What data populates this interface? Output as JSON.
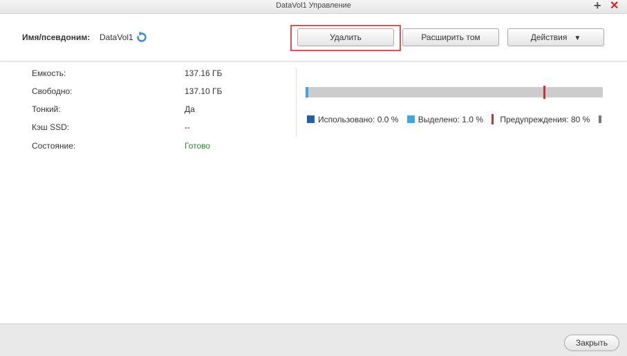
{
  "window": {
    "title": "DataVol1 Управление"
  },
  "header": {
    "alias_label": "Имя/псевдоним:",
    "alias_value": "DataVol1",
    "buttons": {
      "delete": "Удалить",
      "expand": "Расширить том",
      "actions": "Действия"
    }
  },
  "info": [
    {
      "label": "Емкость:",
      "value": "137.16 ГБ"
    },
    {
      "label": "Свободно:",
      "value": "137.10 ГБ"
    },
    {
      "label": "Тонкий:",
      "value": "Да"
    },
    {
      "label": "Кэш SSD:",
      "value": "--"
    },
    {
      "label": "Состояние:",
      "value": "Готово"
    }
  ],
  "usage": {
    "used_percent": 0.0,
    "allocated_percent": 1.0,
    "warning_threshold_percent": 80,
    "legend": {
      "used": "Использовано: 0.0 %",
      "allocated": "Выделено: 1.0 %",
      "warning": "Предупреждения: 80 %"
    }
  },
  "footer": {
    "close_label": "Закрыть"
  },
  "colors": {
    "used": "#1f5fb0",
    "allocated": "#3ba6ee",
    "warning": "#d03030",
    "status_ok": "#2a8a2a",
    "highlight": "#e05050"
  },
  "icons": {
    "refresh": "refresh-icon",
    "plus": "plus-icon",
    "close": "close-icon",
    "dropdown": "caret-down-icon"
  }
}
